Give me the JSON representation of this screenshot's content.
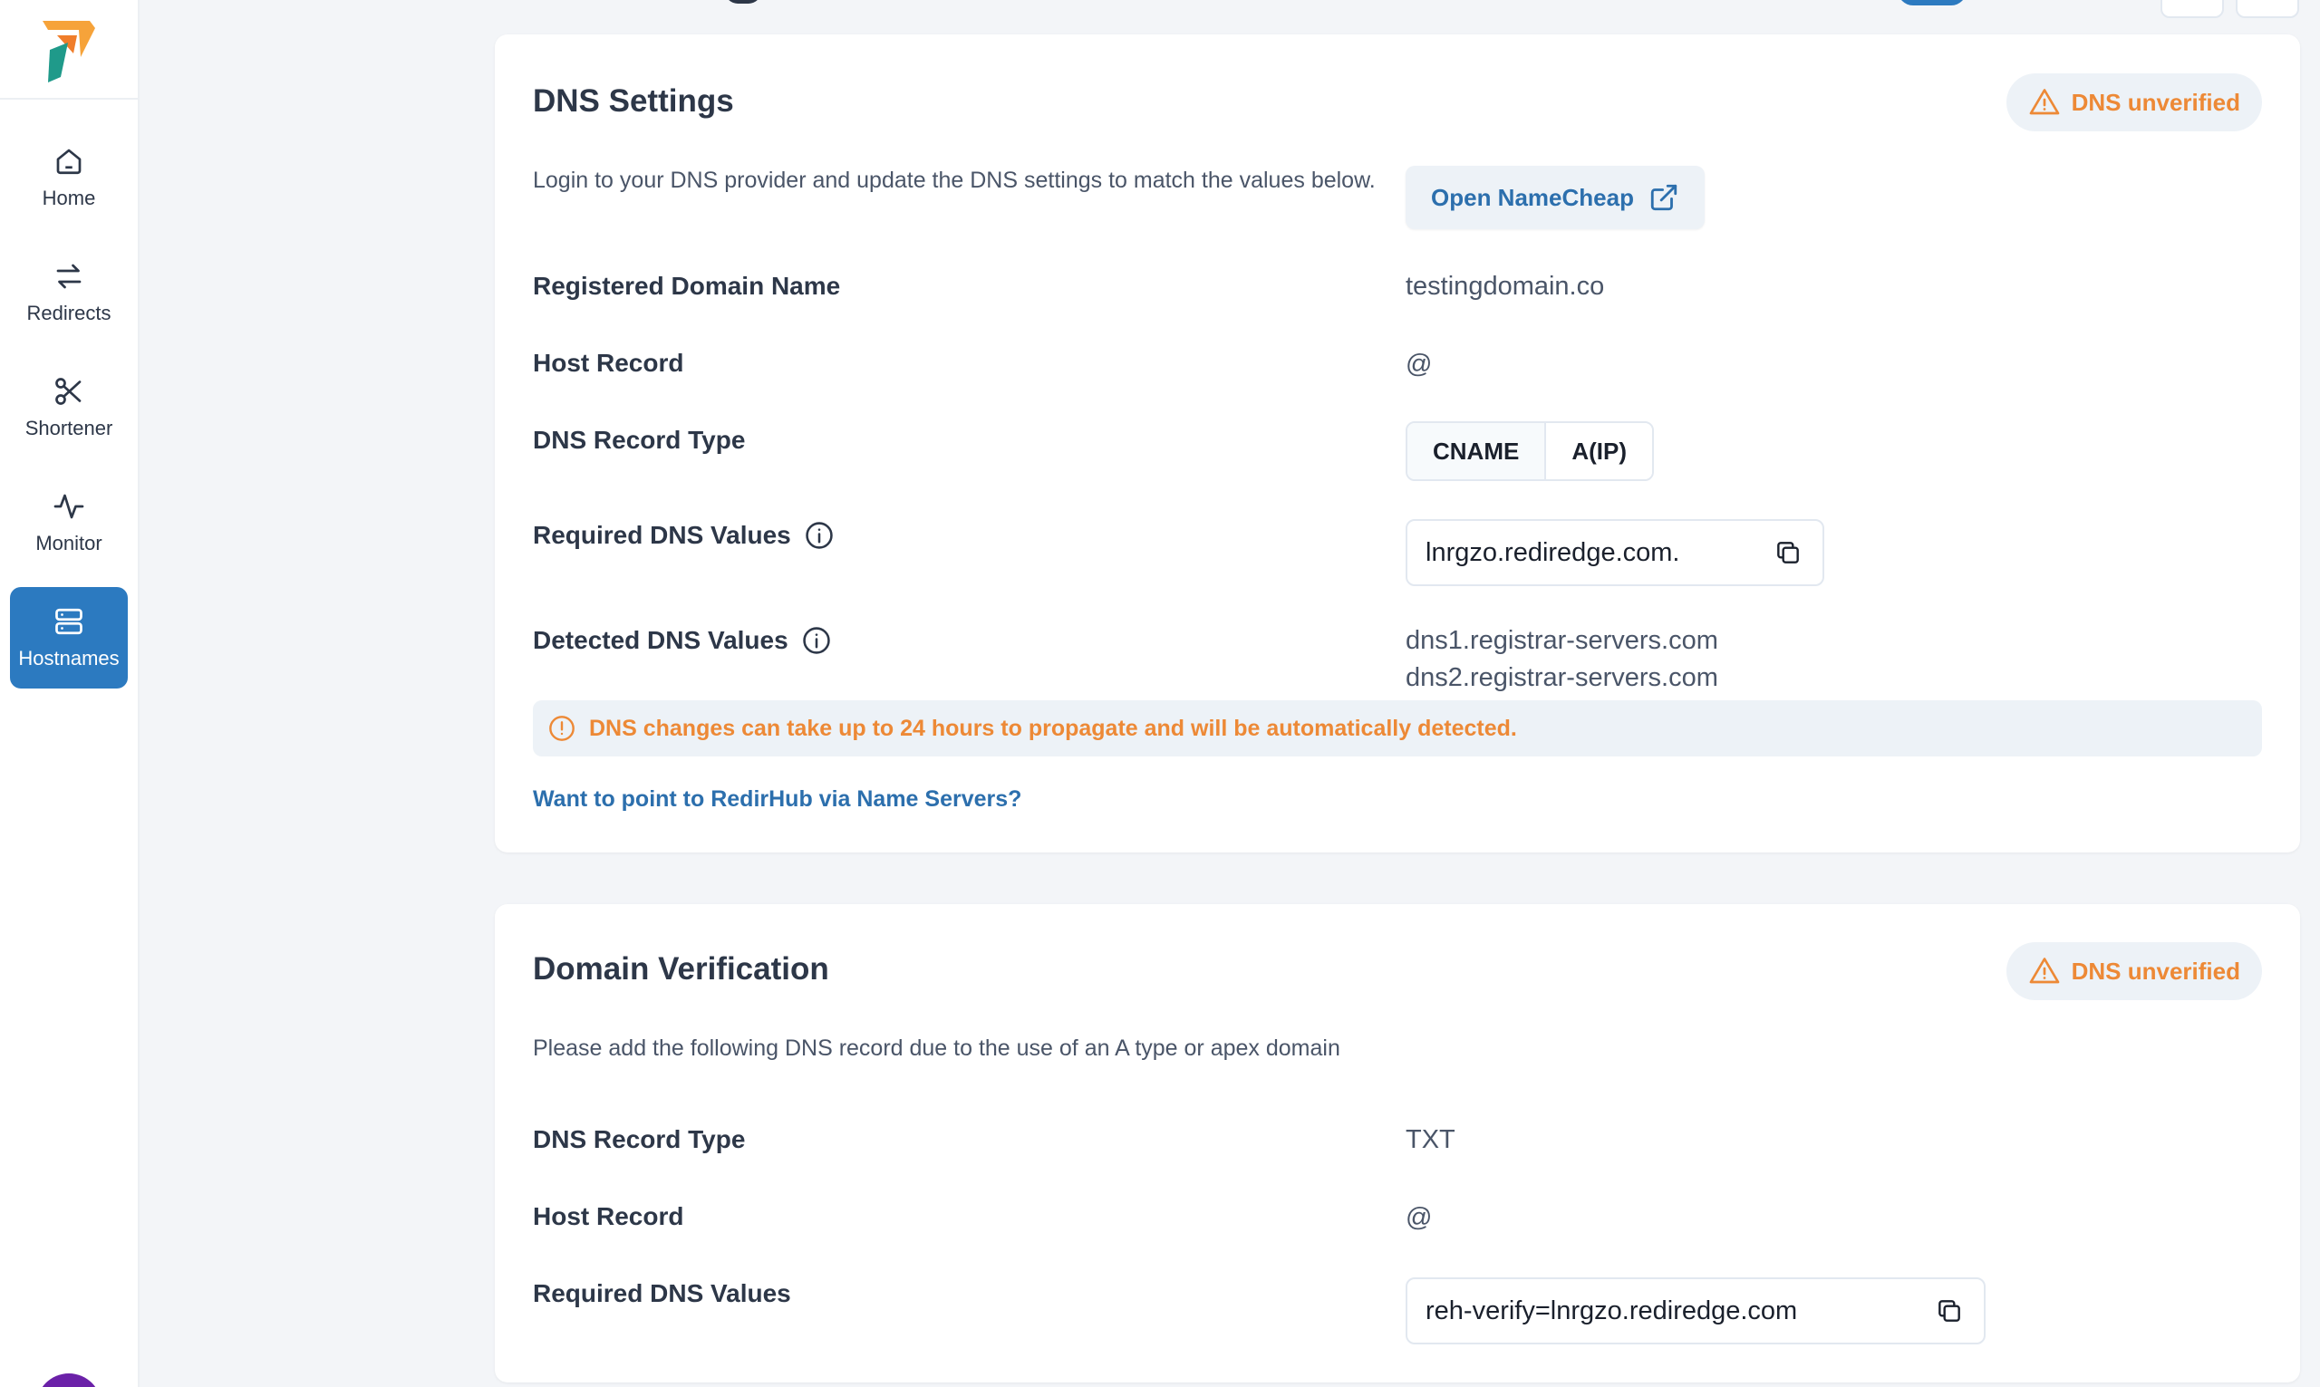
{
  "sidebar": {
    "items": [
      {
        "label": "Home",
        "icon": "home-icon"
      },
      {
        "label": "Redirects",
        "icon": "arrows-swap-icon"
      },
      {
        "label": "Shortener",
        "icon": "scissors-icon"
      },
      {
        "label": "Monitor",
        "icon": "activity-icon"
      },
      {
        "label": "Hostnames",
        "icon": "server-icon",
        "active": true
      }
    ]
  },
  "colors": {
    "accent": "#2c7ac0",
    "warning": "#ed8936",
    "link": "#2c6fad"
  },
  "dns_settings": {
    "title": "DNS Settings",
    "status_badge": "DNS unverified",
    "description": "Login to your DNS provider and update the DNS settings to match the values below.",
    "open_provider_label": "Open NameCheap",
    "registered_domain_label": "Registered Domain Name",
    "registered_domain_value": "testingdomain.co",
    "host_record_label": "Host Record",
    "host_record_value": "@",
    "record_type_label": "DNS Record Type",
    "record_type_options": [
      "CNAME",
      "A(IP)"
    ],
    "record_type_selected": "CNAME",
    "required_values_label": "Required DNS Values",
    "required_value": "lnrgzo.rediredge.com.",
    "detected_values_label": "Detected DNS Values",
    "detected_values": [
      "dns1.registrar-servers.com",
      "dns2.registrar-servers.com"
    ],
    "propagation_notice": "DNS changes can take up to 24 hours to propagate and will be automatically detected.",
    "name_servers_link": "Want to point to RedirHub via Name Servers?"
  },
  "domain_verification": {
    "title": "Domain Verification",
    "status_badge": "DNS unverified",
    "description": "Please add the following DNS record due to the use of an A type or apex domain",
    "record_type_label": "DNS Record Type",
    "record_type_value": "TXT",
    "host_record_label": "Host Record",
    "host_record_value": "@",
    "required_values_label": "Required DNS Values",
    "required_value": "reh-verify=lnrgzo.rediredge.com"
  }
}
